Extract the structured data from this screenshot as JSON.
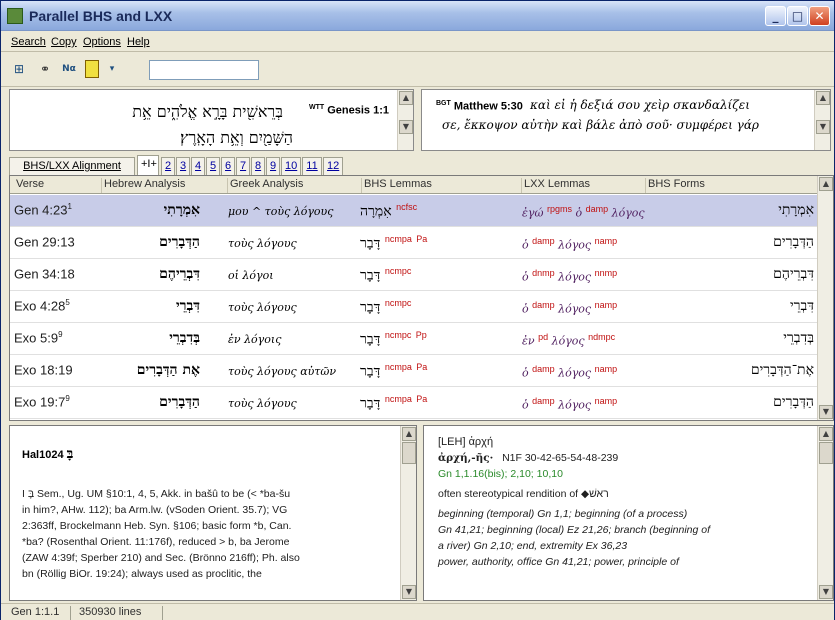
{
  "window": {
    "title": "Parallel BHS and LXX"
  },
  "menu": [
    "Search",
    "Copy",
    "Options",
    "Help"
  ],
  "toolbar": {
    "search_value": "",
    "icons": [
      "layout-icon",
      "binoculars-icon",
      "search-nt-icon",
      "highlighter-icon",
      "dropdown-icon"
    ]
  },
  "left_verse": {
    "line1": "בְּרֵאשִׁ֖ית בָּרָ֣א אֱלֹהִ֑ים אֵ֥ת",
    "ref_tag": "WTT",
    "ref": "Genesis 1:1",
    "line2": "הַשָּׁמַ֖יִם וְאֵ֥ת הָאָֽרֶץ׃"
  },
  "right_verse": {
    "ref_tag": "BGT",
    "ref": "Matthew 5:30",
    "line1": "καὶ εἰ ἡ δεξιά σου χεὶρ σκανδαλίζει",
    "line2": "σε, ἔκκοψον αὐτὴν καὶ βάλε ἀπὸ σοῦ· συμφέρει γάρ"
  },
  "tabs": [
    "BHS/LXX Alignment",
    "+I+",
    "2",
    "3",
    "4",
    "5",
    "6",
    "7",
    "8",
    "9",
    "10",
    "11",
    "12"
  ],
  "grid": {
    "headers": [
      "Verse",
      "Hebrew Analysis",
      "Greek Analysis",
      "BHS Lemmas",
      "LXX Lemmas",
      "BHS Forms"
    ],
    "rows": [
      {
        "verse": "Gen 4:23",
        "sup": "1",
        "heb": "אִמְרָתִי",
        "greek": "μου ^ τοὺς λόγους",
        "lemma": "אִמְרָה",
        "lemma_tag": "ncfsc",
        "lemma_tag2": "",
        "lxx": "ἐγώ",
        "lxx_tag": "rpgms",
        "lxx2": "ὁ",
        "lxx2_tag": "damp",
        "lxx3": "λόγος",
        "lxx3_tag": "",
        "form": "אִמְרָתִי"
      },
      {
        "verse": "Gen 29:13",
        "sup": "",
        "heb": "הַדְּבָרִים",
        "greek": "τοὺς λόγους",
        "lemma": "דָּבָר",
        "lemma_tag": "ncmpa",
        "lemma_tag2": "Pa",
        "lxx": "ὁ",
        "lxx_tag": "damp",
        "lxx2": "λόγος",
        "lxx2_tag": "namp",
        "lxx3": "",
        "lxx3_tag": "",
        "form": "הַדְּבָרִים"
      },
      {
        "verse": "Gen 34:18",
        "sup": "",
        "heb": "דִּבְרֵיהֶם",
        "greek": "οἱ λόγοι",
        "lemma": "דָּבָר",
        "lemma_tag": "ncmpc",
        "lemma_tag2": "",
        "lxx": "ὁ",
        "lxx_tag": "dnmp",
        "lxx2": "λόγος",
        "lxx2_tag": "nnmp",
        "lxx3": "",
        "lxx3_tag": "",
        "form": "דִּבְרֵיהֶם"
      },
      {
        "verse": "Exo 4:28",
        "sup": "5",
        "heb": "דִּבְרֵי",
        "greek": "τοὺς λόγους",
        "lemma": "דָּבָר",
        "lemma_tag": "ncmpc",
        "lemma_tag2": "",
        "lxx": "ὁ",
        "lxx_tag": "damp",
        "lxx2": "λόγος",
        "lxx2_tag": "namp",
        "lxx3": "",
        "lxx3_tag": "",
        "form": "דִּבְרֵי"
      },
      {
        "verse": "Exo 5:9",
        "sup": "9",
        "heb": "בְּדִבְרֵי",
        "greek": "ἐν λόγοις",
        "lemma": "דָּבָר",
        "lemma_tag": "ncmpc",
        "lemma_tag2": "Pp",
        "lxx": "ἐν",
        "lxx_tag": "pd",
        "lxx2": "λόγος",
        "lxx2_tag": "ndmpc",
        "lxx3": "",
        "lxx3_tag": "",
        "form": "בְּדִבְרֵי"
      },
      {
        "verse": "Exo 18:19",
        "sup": "",
        "heb": "אֶת הַדְּבָרִים",
        "greek": "τοὺς λόγους αὐτῶν",
        "lemma": "דָּבָר",
        "lemma_tag": "ncmpa",
        "lemma_tag2": "Pa",
        "lxx": "ὁ",
        "lxx_tag": "damp",
        "lxx2": "λόγος",
        "lxx2_tag": "namp",
        "lxx3": "",
        "lxx3_tag": "",
        "form": "אֶת־הַדְּבָרִים"
      },
      {
        "verse": "Exo 19:7",
        "sup": "9",
        "heb": "הַדְּבָרִים",
        "greek": "τοὺς λόγους",
        "lemma": "דָּבָר",
        "lemma_tag": "ncmpa",
        "lemma_tag2": "Pa",
        "lxx": "ὁ",
        "lxx_tag": "damp",
        "lxx2": "λόγος",
        "lxx2_tag": "namp",
        "lxx3": "",
        "lxx3_tag": "",
        "form": "הַדְּבָרִים"
      }
    ]
  },
  "hal": {
    "id": "Hal1024",
    "heb": "בָּ",
    "lines": [
      "I בָּ Sem., Ug. UM §10:1, 4, 5, Akk. in bašû to be (< *ba-šu",
      "in him?, AHw. 112); ba Arm.lw. (vSoden Orient. 35.7); VG",
      "2:363ff, Brockelmann Heb. Syn. §106; basic form *b, Can.",
      "*ba? (Rosenthal Orient. 11:176f), reduced > b, ba Jerome",
      "(ZAW 4:39f; Sperber 210) and Sec. (Brönno 216ff); Ph. also",
      "bn (Röllig BiOr. 19:24); always used as proclitic, the"
    ]
  },
  "leh": {
    "head": "[LEH] ἀρχή",
    "lemma": "ἀρχή,-ῆς·",
    "codes": "N1F 30-42-65-54-48-239",
    "refs1": "Gn 1,1.16(bis); 2,10; 10,10",
    "lines": [
      "often stereotypical rendition of ◆ראשׁ",
      "beginning (temporal) Gn 1,1; beginning (of a process)",
      "Gn 41,21; beginning (local) Ez 21,26; branch (beginning of",
      "a river) Gn 2,10; end, extremity Ex 36,23",
      "power, authority, office Gn 41,21; power, principle of"
    ]
  },
  "status": {
    "ref": "Gen 1:1.1",
    "lines": "350930 lines"
  }
}
